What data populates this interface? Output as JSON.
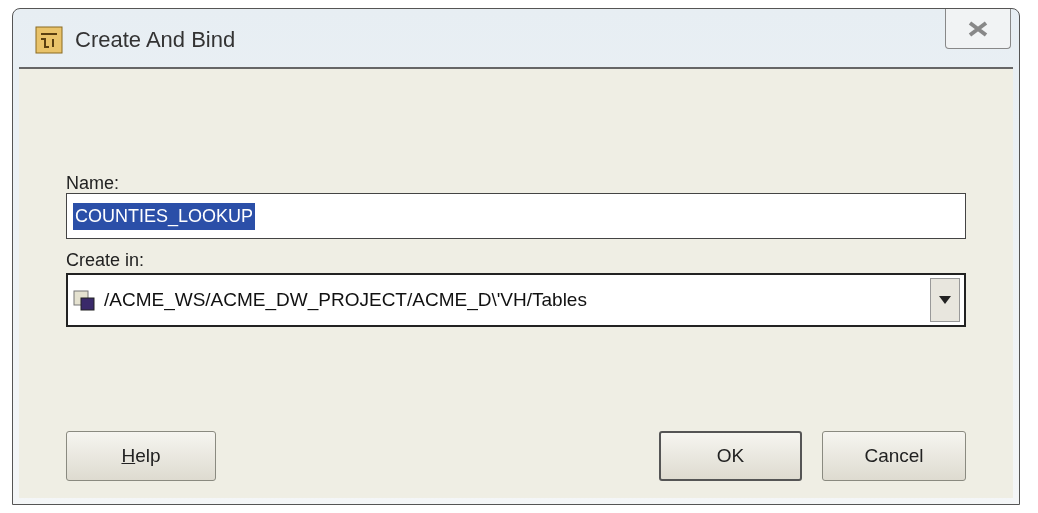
{
  "window": {
    "title": "Create And Bind"
  },
  "name_field": {
    "label": "Name:",
    "value": "COUNTIES_LOOKUP",
    "text_selected": true
  },
  "location_field": {
    "label": "Create in:",
    "value": "/ACME_WS/ACME_DW_PROJECT/ACME_D\\'VH/Tables"
  },
  "buttons": [
    {
      "label": "Help",
      "mnemonic_underlined": true,
      "default": false
    },
    {
      "label": "OK",
      "mnemonic_underlined": false,
      "default": true
    },
    {
      "label": "Cancel",
      "mnemonic_underlined": false,
      "default": false
    }
  ]
}
